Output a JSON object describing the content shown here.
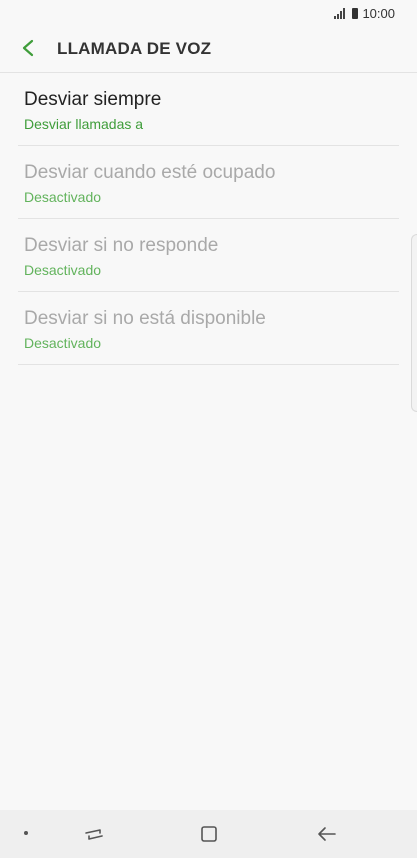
{
  "status_bar": {
    "time": "10:00"
  },
  "header": {
    "title": "LLAMADA DE VOZ"
  },
  "items": [
    {
      "title": "Desviar siempre",
      "subtitle": "Desviar llamadas a"
    },
    {
      "title": "Desviar cuando esté ocupado",
      "subtitle": "Desactivado"
    },
    {
      "title": "Desviar si no responde",
      "subtitle": "Desactivado"
    },
    {
      "title": "Desviar si no está disponible",
      "subtitle": "Desactivado"
    }
  ],
  "colors": {
    "accent": "#3f9d3a",
    "disabled_text": "#a9a9a9"
  },
  "icons": {
    "back": "arrow-left-icon",
    "nav_recent": "recent-apps-icon",
    "nav_home": "home-icon",
    "nav_back": "back-icon"
  }
}
